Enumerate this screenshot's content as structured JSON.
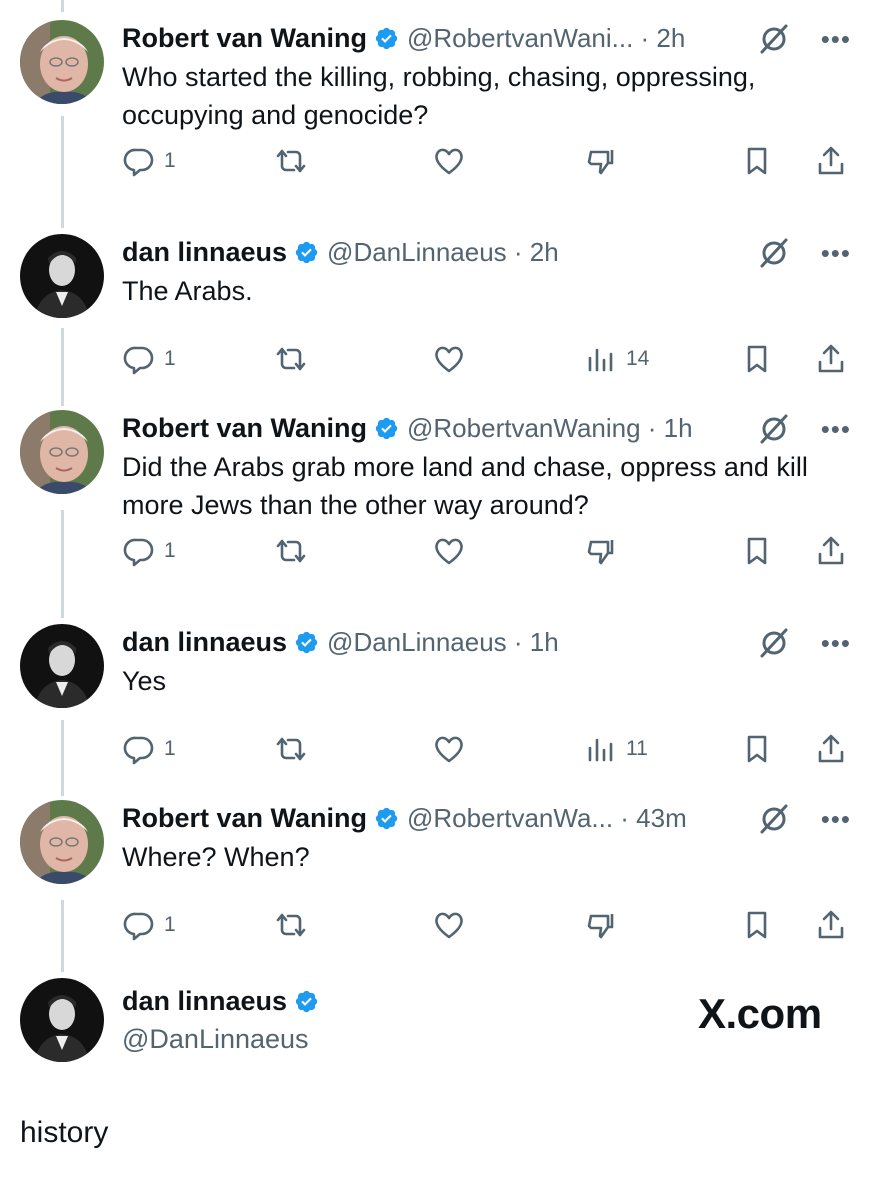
{
  "tweets": [
    {
      "author": "Robert van Waning",
      "handle": "@RobertvanWani... · 2h",
      "text": "Who started the killing, robbing, chasing, oppressing, occupying and genocide?",
      "reply_count": "1",
      "middle_icon": "thumbs-down-icon",
      "middle_count": ""
    },
    {
      "author": "dan linnaeus",
      "handle": "@DanLinnaeus · 2h",
      "text": "The Arabs.",
      "reply_count": "1",
      "middle_icon": "views-icon",
      "middle_count": "14"
    },
    {
      "author": "Robert van Waning",
      "handle": "@RobertvanWaning · 1h",
      "text": "Did the Arabs grab more land and chase, oppress and kill more Jews than the other way around?",
      "reply_count": "1",
      "middle_icon": "thumbs-down-icon",
      "middle_count": ""
    },
    {
      "author": "dan linnaeus",
      "handle": "@DanLinnaeus · 1h",
      "text": "Yes",
      "reply_count": "1",
      "middle_icon": "views-icon",
      "middle_count": "11"
    },
    {
      "author": "Robert van Waning",
      "handle": "@RobertvanWa... · 43m",
      "text": "Where? When?",
      "reply_count": "1",
      "middle_icon": "thumbs-down-icon",
      "middle_count": ""
    }
  ],
  "final_author": {
    "name": "dan linnaeus",
    "handle": "@DanLinnaeus"
  },
  "watermark": "X.com",
  "caption": "history",
  "colors": {
    "verified": "#1d9bf0",
    "secondary_text": "#536471",
    "thread_line": "#cfd9de"
  }
}
